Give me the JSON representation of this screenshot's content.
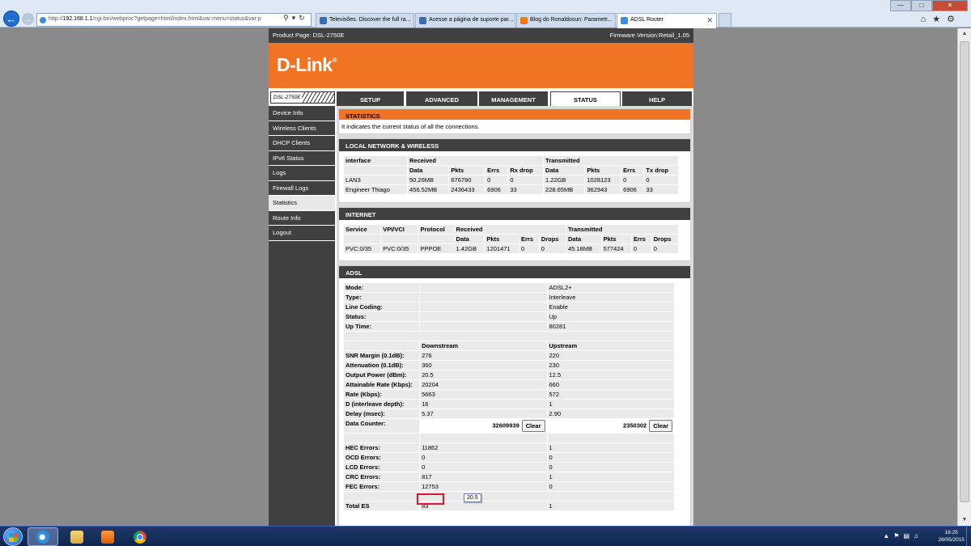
{
  "browser": {
    "url_prefix": "http://",
    "url_host": "192.168.1.1",
    "url_rest": "/cgi-bin/webproc?getpage=html/index.html&var:menu=status&var:p",
    "tabs": [
      {
        "label": "Televisões. Discover the full ra...",
        "color": "#3b6db5"
      },
      {
        "label": "Acesse a página de suporte par...",
        "color": "#3b6db5"
      },
      {
        "label": "Blog do Ronaldosun: Parametr...",
        "color": "#f57c00"
      },
      {
        "label": "ADSL Router",
        "color": "#3b8fd8"
      }
    ]
  },
  "router": {
    "product": "Product Page: DSL-2750E",
    "firmware": "Firmware Version:Retail_1.05",
    "logo": "D-Link",
    "model_badge": "DSL-2750E",
    "nav_tabs": [
      "SETUP",
      "ADVANCED",
      "MANAGEMENT",
      "STATUS",
      "HELP"
    ],
    "active_tab": "STATUS",
    "sidebar": [
      "Device Info",
      "Wireless Clients",
      "DHCP Clients",
      "IPv6 Status",
      "Logs",
      "Firewall Logs",
      "Statistics",
      "Route Info",
      "Logout"
    ],
    "active_sidebar": "Statistics"
  },
  "statistics": {
    "title": "STATISTICS",
    "description": "It indicates the current status of all the connections."
  },
  "lan": {
    "title": "LOCAL NETWORK & WIRELESS",
    "h_interface": "interface",
    "h_received": "Received",
    "h_transmitted": "Transmitted",
    "sub": [
      "Data",
      "Pkts",
      "Errs",
      "Rx drop",
      "Data",
      "Pkts",
      "Errs",
      "Tx drop"
    ],
    "rows": [
      [
        "LAN3",
        "50.26MB",
        "676790",
        "0",
        "0",
        "1.22GB",
        "1028123",
        "0",
        "0"
      ],
      [
        "Engineer Thiago",
        "456.52MB",
        "2436433",
        "6906",
        "33",
        "228.65MB",
        "362943",
        "6906",
        "33"
      ]
    ]
  },
  "internet": {
    "title": "INTERNET",
    "h_service": "Service",
    "h_vpi": "VPI/VCI",
    "h_protocol": "Protocol",
    "h_received": "Received",
    "h_transmitted": "Transmitted",
    "sub": [
      "Data",
      "Pkts",
      "Errs",
      "Drops",
      "Data",
      "Pkts",
      "Errs",
      "Drops"
    ],
    "row": [
      "PVC:0/35",
      "PVC:0/35",
      "PPPOE",
      "1.42GB",
      "1201471",
      "0",
      "0",
      "45.18MB",
      "577424",
      "0",
      "0"
    ]
  },
  "adsl": {
    "title": "ADSL",
    "info": [
      {
        "label": "Mode:",
        "value": "ADSL2+"
      },
      {
        "label": "Type:",
        "value": "Interleave"
      },
      {
        "label": "Line Coding:",
        "value": "Enable"
      },
      {
        "label": "Status:",
        "value": "Up"
      },
      {
        "label": "Up Time:",
        "value": "80281"
      }
    ],
    "h_downstream": "Downstream",
    "h_upstream": "Upstream",
    "metrics": [
      {
        "label": "SNR Margin (0.1dB):",
        "down": "276",
        "up": "220"
      },
      {
        "label": "Attenuation (0.1dB):",
        "down": "360",
        "up": "230"
      },
      {
        "label": "Output Power (dBm):",
        "down": "20.5",
        "up": "12.5"
      },
      {
        "label": "Attainable Rate (Kbps):",
        "down": "20204",
        "up": "660"
      },
      {
        "label": "Rate (Kbps):",
        "down": "5663",
        "up": "572"
      },
      {
        "label": "D (interleave depth):",
        "down": "16",
        "up": "1"
      },
      {
        "label": "Delay (msec):",
        "down": "5.37",
        "up": "2.90"
      }
    ],
    "data_counter_label": "Data Counter:",
    "data_counter_down": "32609939",
    "data_counter_up": "2350302",
    "clear_label": "Clear",
    "errors": [
      {
        "label": "HEC Errors:",
        "down": "11862",
        "up": "1"
      },
      {
        "label": "OCD Errors:",
        "down": "0",
        "up": "0"
      },
      {
        "label": "LCD Errors:",
        "down": "0",
        "up": "0"
      },
      {
        "label": "CRC Errors:",
        "down": "817",
        "up": "1"
      },
      {
        "label": "FEC Errors:",
        "down": "12753",
        "up": "0"
      }
    ],
    "total_es": {
      "label": "Total ES",
      "down": "83",
      "up": "1"
    },
    "tooltip": "20.5"
  },
  "taskbar": {
    "time": "16:25",
    "date": "26/05/2015"
  },
  "colors": {
    "brand_orange": "#f07424",
    "dark_gray": "#404040",
    "highlight_red": "#e0142c"
  }
}
